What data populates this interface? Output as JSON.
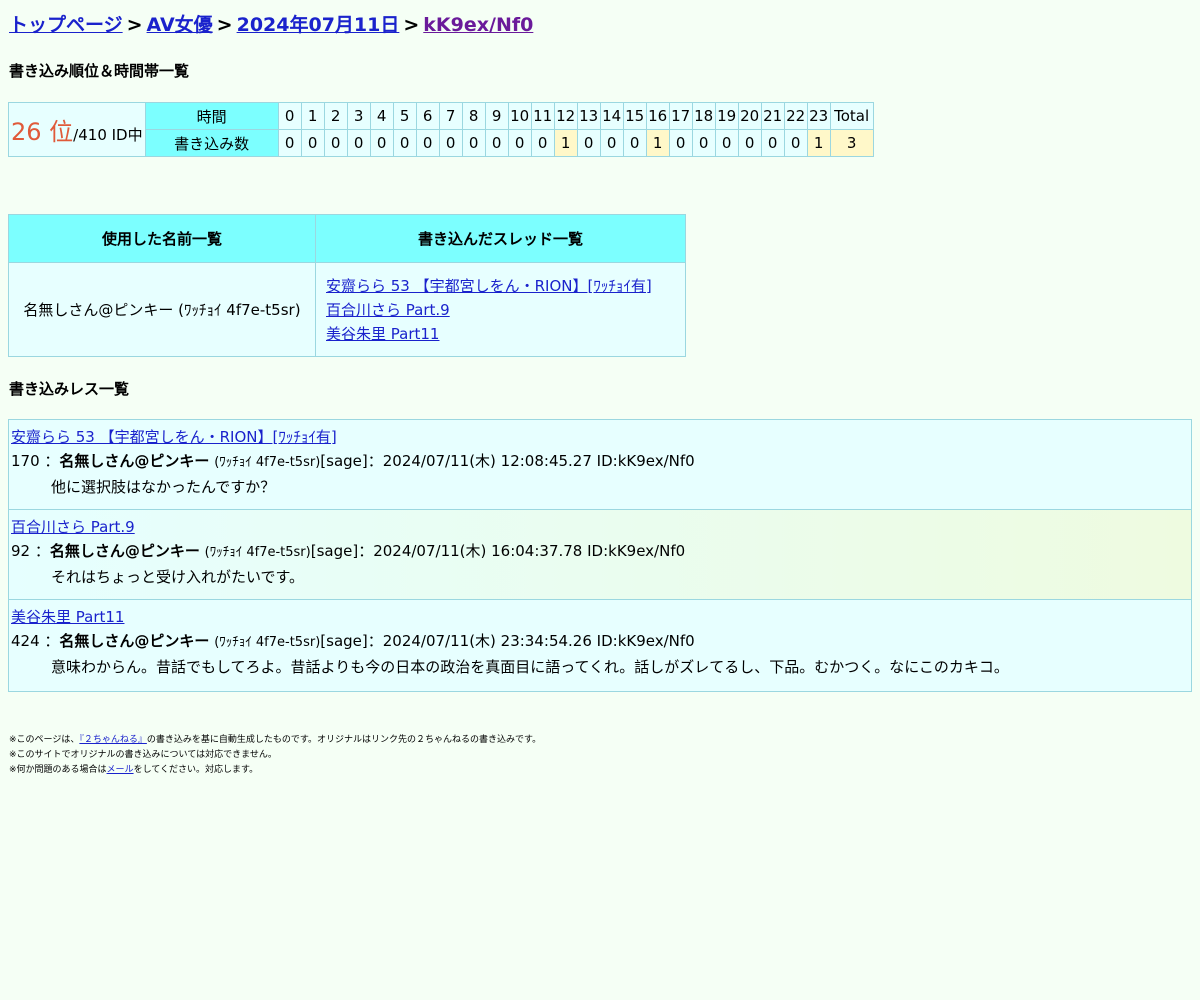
{
  "breadcrumb": {
    "top": "トップページ",
    "board": "AV女優",
    "date": "2024年07月11日",
    "id": "kK9ex/Nf0",
    "separator": ">"
  },
  "rank_section": {
    "heading": "書き込み順位＆時間帯一覧",
    "rank_number": "26 位",
    "rank_of": "/410 ID中",
    "time_label": "時間",
    "count_label": "書き込み数",
    "hours": [
      "0",
      "1",
      "2",
      "3",
      "4",
      "5",
      "6",
      "7",
      "8",
      "9",
      "10",
      "11",
      "12",
      "13",
      "14",
      "15",
      "16",
      "17",
      "18",
      "19",
      "20",
      "21",
      "22",
      "23"
    ],
    "total_label": "Total",
    "counts": [
      "0",
      "0",
      "0",
      "0",
      "0",
      "0",
      "0",
      "0",
      "0",
      "0",
      "0",
      "0",
      "1",
      "0",
      "0",
      "0",
      "1",
      "0",
      "0",
      "0",
      "0",
      "0",
      "0",
      "1"
    ],
    "total": "3",
    "highlight_color": "#fff8c9"
  },
  "summary": {
    "names_header": "使用した名前一覧",
    "threads_header": "書き込んだスレッド一覧",
    "names": [
      "名無しさん@ピンキー (ﾜｯﾁｮｲ 4f7e-t5sr)"
    ],
    "threads": [
      "安齋らら 53 【宇都宮しをん・RION】[ﾜｯﾁｮｲ有]",
      "百合川さら Part.9",
      "美谷朱里 Part11"
    ]
  },
  "posts_section": {
    "heading": "書き込みレス一覧",
    "posts": [
      {
        "thread": "安齋らら 53 【宇都宮しをん・RION】[ﾜｯﾁｮｲ有]",
        "num": "170 ：",
        "name": "名無しさん@ピンキー",
        "trip": "(ﾜｯﾁｮｲ 4f7e-t5sr)",
        "rest": "[sage]：2024/07/11(木) 12:08:45.27 ID:kK9ex/Nf0",
        "body": "他に選択肢はなかったんですか？"
      },
      {
        "thread": "百合川さら Part.9",
        "num": "92 ：",
        "name": "名無しさん@ピンキー",
        "trip": "(ﾜｯﾁｮｲ 4f7e-t5sr)",
        "rest": "[sage]：2024/07/11(木) 16:04:37.78 ID:kK9ex/Nf0",
        "body": "それはちょっと受け入れがたいです。"
      },
      {
        "thread": "美谷朱里 Part11",
        "num": "424 ：",
        "name": "名無しさん@ピンキー",
        "trip": "(ﾜｯﾁｮｲ 4f7e-t5sr)",
        "rest": "[sage]：2024/07/11(木) 23:34:54.26 ID:kK9ex/Nf0",
        "body": "意味わからん。昔話でもしてろよ。昔話よりも今の日本の政治を真面目に語ってくれ。話しがズレてるし、下品。むかつく。なにこのカキコ。"
      }
    ]
  },
  "footer": {
    "line1_pre": "※このページは、",
    "line1_link": "『２ちゃんねる』",
    "line1_post": "の書き込みを基に自動生成したものです。オリジナルはリンク先の２ちゃんねるの書き込みです。",
    "line2": "※このサイトでオリジナルの書き込みについては対応できません。",
    "line3_pre": "※何か問題のある場合は",
    "line3_link": "メール",
    "line3_post": "をしてください。対応します。"
  }
}
